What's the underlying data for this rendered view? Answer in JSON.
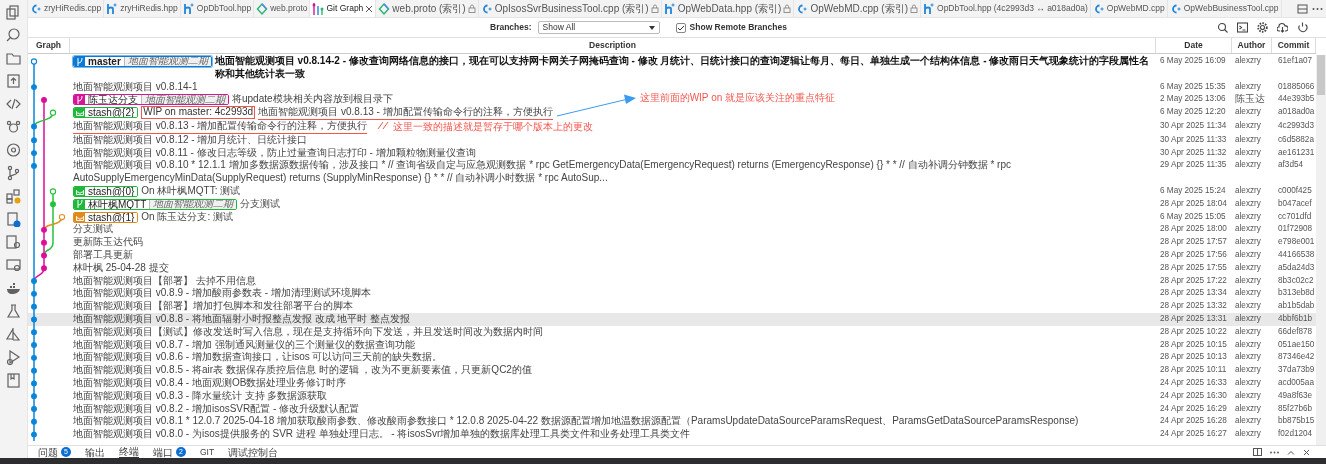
{
  "tabs": [
    {
      "label": "zryHiRedis.cpp",
      "kind": "cpp",
      "selected": false,
      "locked": false
    },
    {
      "label": "zryHiRedis.hpp",
      "kind": "hpp",
      "selected": false,
      "locked": false
    },
    {
      "label": "OpDbTool.hpp",
      "kind": "hpp",
      "selected": false,
      "locked": false
    },
    {
      "label": "web.proto",
      "kind": "proto",
      "selected": false,
      "locked": false
    },
    {
      "label": "Git Graph",
      "kind": "git",
      "selected": true,
      "locked": false
    },
    {
      "label": "web.proto (索引)",
      "kind": "proto",
      "selected": false,
      "locked": true
    },
    {
      "label": "OpIsosSvrBusinessTool.cpp (索引)",
      "kind": "cpp",
      "selected": false,
      "locked": true
    },
    {
      "label": "OpWebData.hpp (索引)",
      "kind": "hpp",
      "selected": false,
      "locked": true
    },
    {
      "label": "OpWebMD.cpp (索引)",
      "kind": "cpp",
      "selected": false,
      "locked": true
    },
    {
      "label": "OpDbTool.hpp (4c2993d3 ↔ a018ad0a)",
      "kind": "hpp",
      "selected": false,
      "locked": false
    },
    {
      "label": "OpWebMD.cpp",
      "kind": "cpp",
      "selected": false,
      "locked": false
    },
    {
      "label": "OpWebBusinessTool.cpp",
      "kind": "cpp",
      "selected": false,
      "locked": false
    }
  ],
  "toolbar": {
    "branches_label": "Branches:",
    "branches_value": "Show All",
    "remote_label": "Show Remote Branches",
    "remote_checked": true
  },
  "columns": [
    "Graph",
    "Description",
    "Date",
    "Author",
    "Commit"
  ],
  "rows": [
    {
      "refs": [
        {
          "kind": "branch",
          "name": "master",
          "remote": "地面智能观测二期",
          "color": "#0a7ad6"
        }
      ],
      "description": "地面智能观测项目 v0.8.14-2 - 修改查询网络信息的接口，现在可以支持网卡网关子网掩码查询 - 修改 月统计、日统计接口的查询逻辑让每月、每日、单独生成一个结构体信息 - 修改雨日天气现象统计的字段属性名称和其他统计表一致",
      "date": "6 May 2025 16:09",
      "author": "alexzry",
      "commit": "61ef1a07",
      "current": true,
      "selected": false,
      "underlined": false
    },
    {
      "description": "地面智能观测项目 v0.8.14-1",
      "date": "6 May 2025 15:35",
      "author": "alexzry",
      "commit": "01885066",
      "current": false,
      "selected": false,
      "underlined": false
    },
    {
      "refs": [
        {
          "kind": "branch",
          "name": "陈玉达分支",
          "remote": "地面智能观测二期",
          "color": "#d6159a"
        }
      ],
      "description": "将update模块相关内容放到根目录下",
      "date": "2 May 2025 13:06",
      "author": "陈玉达",
      "commit": "44e393b5",
      "current": false,
      "selected": false,
      "underlined": false
    },
    {
      "refs": [
        {
          "kind": "stash",
          "name": "stash@{2}",
          "color": "#1fb83a"
        }
      ],
      "prefix": "WIP on master: 4c2993d",
      "description": "地面智能观测项目 v0.8.13 - 增加配置传输命令行的注释，方便执行",
      "date": "6 May 2025 12:20",
      "author": "alexzry",
      "commit": "a018ad0a",
      "current": false,
      "selected": false,
      "underlined": true
    },
    {
      "description": "地面智能观测项目 v0.8.13 - 增加配置传输命令行的注释，方便执行",
      "date": "30 Apr 2025 11:34",
      "author": "alexzry",
      "commit": "4c2993d3",
      "current": false,
      "selected": false,
      "underlined": true
    },
    {
      "description": "地面智能观测项目 v0.8.12 - 增加月统计、日统计接口",
      "date": "30 Apr 2025 11:33",
      "author": "alexzry",
      "commit": "c6d5882a",
      "current": false,
      "selected": false,
      "underlined": false
    },
    {
      "description": "地面智能观测项目 v0.8.11 - 修改日志等级，防止过量查询日志打印 - 增加颗粒物测量仪查询",
      "date": "30 Apr 2025 11:32",
      "author": "alexzry",
      "commit": "ae161231",
      "current": false,
      "selected": false,
      "underlined": false
    },
    {
      "description": "地面智能观测项目 v0.8.10 * 12.1.1 增加多数据源数据传输，涉及接口 * // 查询省级自定与应急观测数据 * rpc GetEmergencyData(EmergencyRequest) returns (EmergencyResponse) {} * * // 自动补调分钟数据 * rpc AutoSupplyEmergencyMinData(SupplyRequest) returns (SupplyMinResponse) {} * * // 自动补调小时数据 * rpc AutoSup...",
      "date": "29 Apr 2025 11:35",
      "author": "alexzry",
      "commit": "af3d54",
      "current": false,
      "selected": false,
      "underlined": false
    },
    {
      "refs": [
        {
          "kind": "stash",
          "name": "stash@{0}",
          "color": "#1fb83a"
        }
      ],
      "description": "On 林叶枫MQTT: 测试",
      "date": "6 May 2025 15:24",
      "author": "alexzry",
      "commit": "c000f425",
      "current": false,
      "selected": false,
      "underlined": false
    },
    {
      "refs": [
        {
          "kind": "branch",
          "name": "林叶枫MQTT",
          "remote": "地面智能观测二期",
          "color": "#1fb83a"
        }
      ],
      "description": "分支测试",
      "date": "28 Apr 2025 18:04",
      "author": "alexzry",
      "commit": "b047acef",
      "current": false,
      "selected": false,
      "underlined": false
    },
    {
      "refs": [
        {
          "kind": "stash",
          "name": "stash@{1}",
          "color": "#e08a1e"
        }
      ],
      "description": "On 陈玉达分支: 测试",
      "date": "6 May 2025 15:05",
      "author": "alexzry",
      "commit": "cc701dfd",
      "current": false,
      "selected": false,
      "underlined": false
    },
    {
      "description": "分支测试",
      "date": "28 Apr 2025 18:00",
      "author": "alexzry",
      "commit": "01f72908",
      "current": false,
      "selected": false,
      "underlined": false
    },
    {
      "description": "更新陈玉达代码",
      "date": "28 Apr 2025 17:57",
      "author": "alexzry",
      "commit": "e798e001",
      "current": false,
      "selected": false,
      "underlined": false
    },
    {
      "description": "部署工具更新",
      "date": "28 Apr 2025 17:56",
      "author": "alexzry",
      "commit": "44166538",
      "current": false,
      "selected": false,
      "underlined": false
    },
    {
      "description": "林叶枫 25-04-28 提交",
      "date": "28 Apr 2025 17:55",
      "author": "alexzry",
      "commit": "a5da24d3",
      "current": false,
      "selected": false,
      "underlined": false
    },
    {
      "description": "地面智能观测项目【部署】 去掉不用信息",
      "date": "28 Apr 2025 17:22",
      "author": "alexzry",
      "commit": "8b3c02c2",
      "current": false,
      "selected": false,
      "underlined": false
    },
    {
      "description": "地面智能观测项目 v0.8.9 - 增加酸雨参数表 - 增加清理测试环境脚本",
      "date": "28 Apr 2025 13:34",
      "author": "alexzry",
      "commit": "b313eb8d",
      "current": false,
      "selected": false,
      "underlined": false
    },
    {
      "description": "地面智能观测项目【部署】增加打包脚本和发往部署平台的脚本",
      "date": "28 Apr 2025 13:32",
      "author": "alexzry",
      "commit": "ab1b5dab",
      "current": false,
      "selected": false,
      "underlined": false
    },
    {
      "description": "地面智能观测项目 v0.8.8 - 将地面辐射小时报整点发报 改成 地平时 整点发报",
      "date": "28 Apr 2025 13:31",
      "author": "alexzry",
      "commit": "4bbf6b1b",
      "current": false,
      "selected": true,
      "underlined": false
    },
    {
      "description": "地面智能观测项目【测试】修改发送时写入信息，现在是支持循环向下发送，并且发送时间改为数据内时间",
      "date": "28 Apr 2025 10:22",
      "author": "alexzry",
      "commit": "66def878",
      "current": false,
      "selected": false,
      "underlined": false
    },
    {
      "description": "地面智能观测项目 v0.8.7 - 增加 强制通风测量仪的三个测量仪的数据查询功能",
      "date": "28 Apr 2025 10:15",
      "author": "alexzry",
      "commit": "051ae150",
      "current": false,
      "selected": false,
      "underlined": false
    },
    {
      "description": "地面智能观测项目 v0.8.6 - 增加数据查询接口，让isos 可以访问三天前的缺失数据。",
      "date": "28 Apr 2025 10:13",
      "author": "alexzry",
      "commit": "87346e42",
      "current": false,
      "selected": false,
      "underlined": false
    },
    {
      "description": "地面智能观测项目 v0.8.5 - 将air表 数据保存质控后信息 时的逻辑 ，改为不更新要素值，只更新QC2的值",
      "date": "28 Apr 2025 10:11",
      "author": "alexzry",
      "commit": "37da73b9",
      "current": false,
      "selected": false,
      "underlined": false
    },
    {
      "description": "地面智能观测项目 v0.8.4 - 地面观测OB数据处理业务修订时序",
      "date": "24 Apr 2025 16:33",
      "author": "alexzry",
      "commit": "acd005aa",
      "current": false,
      "selected": false,
      "underlined": false
    },
    {
      "description": "地面智能观测项目 v0.8.3 - 降水量统计 支持 多数据源获取",
      "date": "24 Apr 2025 16:30",
      "author": "alexzry",
      "commit": "49a8f63e",
      "current": false,
      "selected": false,
      "underlined": false
    },
    {
      "description": "地面智能观测项目 v0.8.2 - 增加isosSVR配置 - 修改升级默认配置",
      "date": "24 Apr 2025 16:29",
      "author": "alexzry",
      "commit": "85f27b6b",
      "current": false,
      "selected": false,
      "underlined": false
    },
    {
      "description": "地面智能观测项目 v0.8.1 * 12.0.7 2025-04-18 增加获取酸雨参数、修改酸雨参数接口 * 12.0.8 2025-04-22 数据源配置增加地温数据源配置（ParamsUpdateDataSourceParamsRequest、ParamsGetDataSourceParamsResponse)",
      "date": "24 Apr 2025 16:28",
      "author": "alexzry",
      "commit": "bb875b15",
      "current": false,
      "selected": false,
      "underlined": false
    },
    {
      "description": "地面智能观测项目 v0.8.0 - 为isos提供服务的 SVR 进程 单独处理日志。 - 将isosSvr增加单独的数据库处理工具类文件和业务处理工具类文件",
      "date": "24 Apr 2025 16:27",
      "author": "alexzry",
      "commit": "f02d1204",
      "current": false,
      "selected": false,
      "underlined": false
    }
  ],
  "annotations": [
    {
      "kind": "arrow",
      "text": "这里前面的WIP on 就是应该关注的重点特征"
    },
    {
      "kind": "slash",
      "text": "这里一致的描述就是暂存于哪个版本上的更改"
    }
  ],
  "panel_tabs": [
    {
      "label": "问题",
      "badge": "5",
      "selected": false
    },
    {
      "label": "输出",
      "selected": false
    },
    {
      "label": "终端",
      "selected": true
    },
    {
      "label": "端口",
      "badge": "2",
      "selected": false
    },
    {
      "label": "GIT",
      "selected": false
    },
    {
      "label": "调试控制台",
      "selected": false
    }
  ]
}
